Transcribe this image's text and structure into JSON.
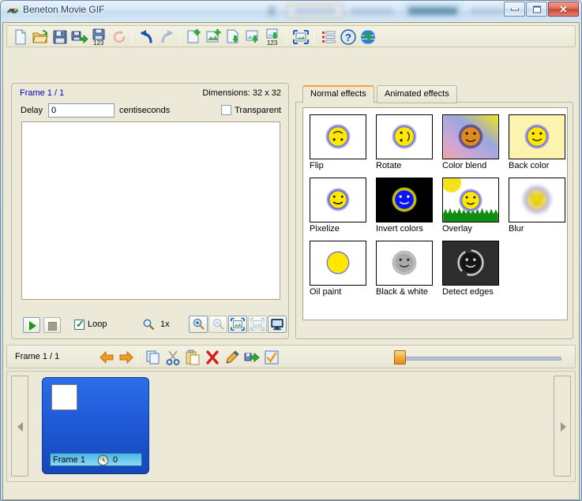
{
  "window": {
    "title": "Beneton Movie GIF",
    "app_icon": "beneton-logo-icon",
    "minimize_label": "Minimize",
    "maximize_label": "Maximize",
    "close_label": "Close"
  },
  "toolbar": {
    "items": [
      {
        "name": "new-icon",
        "label": "New"
      },
      {
        "name": "open-folder-icon",
        "label": "Open"
      },
      {
        "name": "save-icon",
        "label": "Save"
      },
      {
        "name": "save-as-icon",
        "label": "Save as"
      },
      {
        "name": "save-numbered-icon",
        "label": "Save frames numbered"
      },
      {
        "name": "refresh-icon",
        "label": "Refresh"
      },
      {
        "name": "undo-icon",
        "label": "Undo"
      },
      {
        "name": "redo-icon",
        "label": "Redo"
      },
      {
        "name": "new-frame-icon",
        "label": "New frame"
      },
      {
        "name": "insert-image-icon",
        "label": "Insert image"
      },
      {
        "name": "import-file-icon",
        "label": "Import file"
      },
      {
        "name": "import-image-icon",
        "label": "Import image"
      },
      {
        "name": "import-numbered-icon",
        "label": "Import numbered images"
      },
      {
        "name": "resize-canvas-icon",
        "label": "Resize canvas"
      },
      {
        "name": "properties-list-icon",
        "label": "Properties"
      },
      {
        "name": "help-icon",
        "label": "Help"
      },
      {
        "name": "web-globe-icon",
        "label": "Website"
      }
    ]
  },
  "preview": {
    "frame_label": "Frame 1 / 1",
    "dimensions_label": "Dimensions: 32 x 32",
    "delay_label": "Delay",
    "delay_value": "0",
    "delay_units": "centiseconds",
    "transparent_label": "Transparent",
    "transparent_checked": false,
    "play_label": "Play",
    "stop_label": "Stop",
    "loop_label": "Loop",
    "loop_checked": true,
    "zoom_icon": "magnifier-icon",
    "zoom_level": "1x",
    "zoom_buttons": [
      {
        "name": "zoom-in-button",
        "label": "Zoom in",
        "enabled": true
      },
      {
        "name": "zoom-out-button",
        "label": "Zoom out",
        "enabled": false
      },
      {
        "name": "fit-image-button",
        "label": "Fit to image",
        "enabled": true
      },
      {
        "name": "fit-window-button",
        "label": "Fit to window",
        "enabled": false
      },
      {
        "name": "actual-size-button",
        "label": "Actual size",
        "enabled": true
      }
    ]
  },
  "effects": {
    "tabs": [
      {
        "label": "Normal effects",
        "active": true
      },
      {
        "label": "Animated effects",
        "active": false
      }
    ],
    "items": [
      {
        "label": "Flip",
        "name": "effect-flip"
      },
      {
        "label": "Rotate",
        "name": "effect-rotate"
      },
      {
        "label": "Color blend",
        "name": "effect-color-blend"
      },
      {
        "label": "Back color",
        "name": "effect-back-color"
      },
      {
        "label": "Pixelize",
        "name": "effect-pixelize"
      },
      {
        "label": "Invert colors",
        "name": "effect-invert-colors"
      },
      {
        "label": "Overlay",
        "name": "effect-overlay"
      },
      {
        "label": "Blur",
        "name": "effect-blur"
      },
      {
        "label": "Oil paint",
        "name": "effect-oil-paint"
      },
      {
        "label": "Black & white",
        "name": "effect-black-and-white"
      },
      {
        "label": "Detect edges",
        "name": "effect-detect-edges"
      }
    ]
  },
  "frame_strip_bar": {
    "frame_label": "Frame 1 / 1",
    "prev_label": "Previous frame",
    "next_label": "Next frame",
    "actions": [
      {
        "name": "copy-icon",
        "label": "Copy"
      },
      {
        "name": "cut-scissors-icon",
        "label": "Cut"
      },
      {
        "name": "paste-icon",
        "label": "Paste"
      },
      {
        "name": "delete-x-icon",
        "label": "Delete"
      },
      {
        "name": "edit-pencil-icon",
        "label": "Edit"
      },
      {
        "name": "move-frame-icon",
        "label": "Move frame"
      },
      {
        "name": "select-check-icon",
        "label": "Select"
      }
    ],
    "slider_value": 8
  },
  "frame_strip": {
    "scroll_left_label": "Scroll left",
    "scroll_right_label": "Scroll right",
    "frames": [
      {
        "name": "Frame 1",
        "delay": "0",
        "selected": true
      }
    ]
  },
  "colors": {
    "accent_orange": "#f7a32b",
    "selection_blue": "#1f5ad8",
    "panel_bg": "#ece9d8",
    "link_blue": "#0000cc",
    "smiley_yellow": "#ffe800",
    "smiley_rim": "#6a6ad4"
  }
}
